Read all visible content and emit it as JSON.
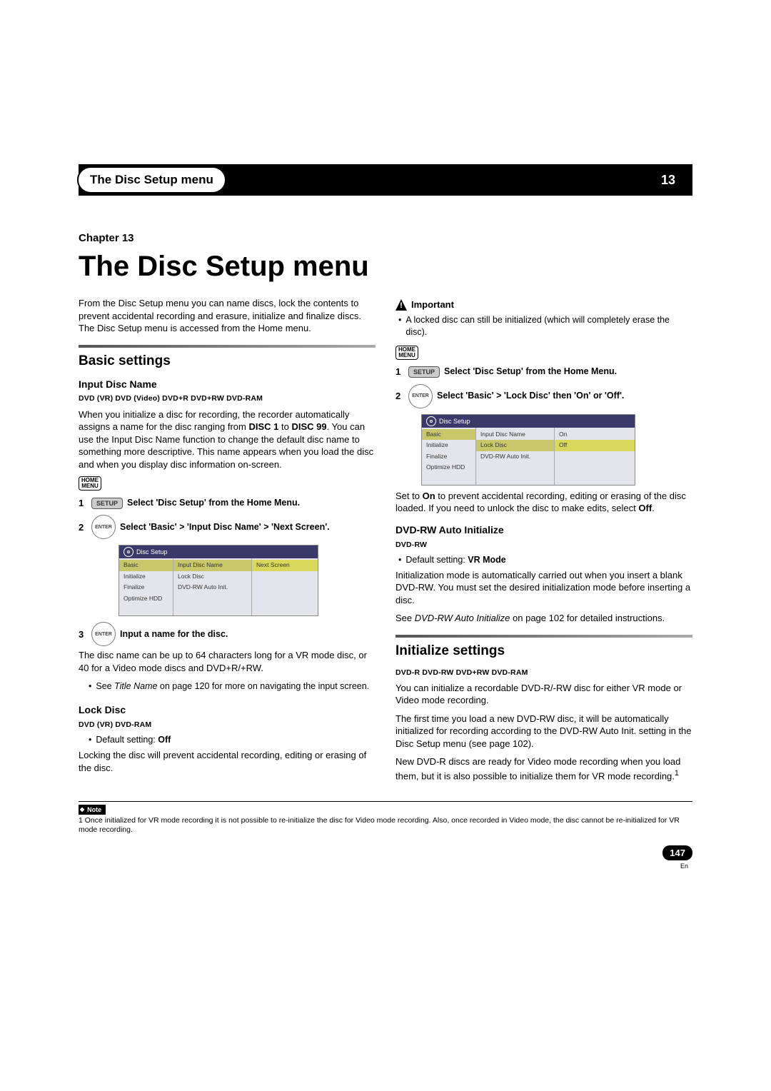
{
  "header": {
    "tab": "The Disc Setup menu",
    "chapter_num": "13"
  },
  "chapter": {
    "label": "Chapter 13",
    "title": "The Disc Setup menu",
    "intro": "From the Disc Setup menu you can name discs, lock the contents to prevent accidental recording and erasure, initialize and finalize discs. The Disc Setup menu is accessed from the Home menu."
  },
  "basic": {
    "title": "Basic settings",
    "input_name": {
      "heading": "Input Disc Name",
      "badges": "DVD (VR)  DVD (Video)  DVD+R  DVD+RW  DVD-RAM",
      "p1a": "When you initialize a disc for recording, the recorder automatically assigns a name for the disc ranging from ",
      "p1b": "DISC 1",
      "p1c": " to ",
      "p1d": "DISC 99",
      "p1e": ". You can use the Input Disc Name function to change the default disc name to something more descriptive. This name appears when you load the disc and when you display disc information on-screen.",
      "home_menu": "HOME\nMENU",
      "step1": "Select 'Disc Setup' from the Home Menu.",
      "setup": "SETUP",
      "step2": "  Select 'Basic' > 'Input Disc Name' > 'Next Screen'.",
      "enter": "ENTER",
      "step3": "  Input a name for the disc.",
      "p2": "The disc name can be up to 64 characters long for a VR mode disc, or 40 for a Video mode discs and DVD+R/+RW.",
      "bullet_a": "See ",
      "bullet_b": "Title Name",
      "bullet_c": " on page 120 for more on navigating the input screen."
    },
    "lock": {
      "heading": "Lock Disc",
      "badges": "DVD (VR)  DVD-RAM",
      "default": "Default setting: ",
      "default_val": "Off",
      "p": "Locking the disc will prevent accidental recording, editing or erasing of the disc."
    }
  },
  "right": {
    "important_label": "Important",
    "important_bullet": "A locked disc can still be initialized (which will completely erase the disc).",
    "home_menu": "HOME\nMENU",
    "setup": "SETUP",
    "step1": "Select 'Disc Setup' from the Home Menu.",
    "enter": "ENTER",
    "step2": "  Select 'Basic' > 'Lock Disc' then 'On' or 'Off'.",
    "p_after_a": "Set to ",
    "p_after_b": "On",
    "p_after_c": " to prevent accidental recording, editing or erasing of the disc loaded. If you need to unlock the disc to make edits, select ",
    "p_after_d": "Off",
    "p_after_e": ".",
    "auto_init": {
      "heading": "DVD-RW Auto Initialize",
      "badges": "DVD-RW",
      "default": "Default setting: ",
      "default_val": "VR Mode",
      "p1": "Initialization mode is automatically carried out when you insert a blank DVD-RW. You must set the desired initialization mode before inserting a disc.",
      "p2a": "See ",
      "p2b": "DVD-RW Auto Initialize",
      "p2c": " on page 102 for detailed instructions."
    }
  },
  "initialize": {
    "title": "Initialize settings",
    "badges": "DVD-R  DVD-RW  DVD+RW  DVD-RAM",
    "p1": "You can initialize a recordable DVD-R/-RW disc for either VR mode or Video mode recording.",
    "p2": "The first time you load a new DVD-RW disc, it will be automatically initialized for recording according to the DVD-RW Auto Init. setting in the Disc Setup menu (see page 102).",
    "p3": "New DVD-R discs are ready for Video mode recording when you load them, but it is also possible to initialize them for VR mode recording.",
    "sup": "1"
  },
  "shot1": {
    "header": "Disc Setup",
    "side": [
      "Basic",
      "Initialize",
      "Finalize",
      "Optimize HDD"
    ],
    "mid": [
      "Input Disc Name",
      "Lock Disc",
      "DVD-RW Auto Init."
    ],
    "right": [
      "Next Screen"
    ]
  },
  "shot2": {
    "header": "Disc Setup",
    "side": [
      "Basic",
      "Initialize",
      "Finalize",
      "Optimize HDD"
    ],
    "mid": [
      "Input Disc Name",
      "Lock Disc",
      "DVD-RW Auto Init."
    ],
    "right": [
      "On",
      "Off"
    ]
  },
  "note": {
    "label": "Note",
    "text": "1  Once initialized for VR mode recording it is not possible to re-initialize the disc for Video mode recording. Also, once recorded in Video mode, the disc cannot be re-initialized for VR mode recording."
  },
  "page": {
    "num": "147",
    "lang": "En"
  }
}
